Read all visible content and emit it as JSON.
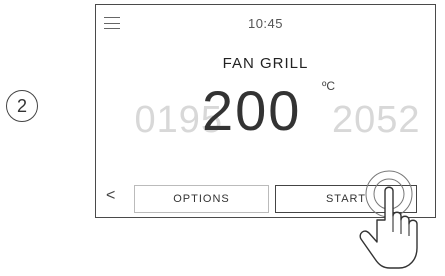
{
  "step_number": "2",
  "screen": {
    "time": "10:45",
    "mode": "FAN GRILL",
    "temperature": {
      "previous_values": "0195",
      "current": "200",
      "unit": "ºC",
      "next_values": "2052"
    },
    "buttons": {
      "back": "<",
      "options": "OPTIONS",
      "start": "START"
    }
  },
  "icons": {
    "menu": "hamburger-menu-icon",
    "pointer": "hand-pointer-icon"
  }
}
